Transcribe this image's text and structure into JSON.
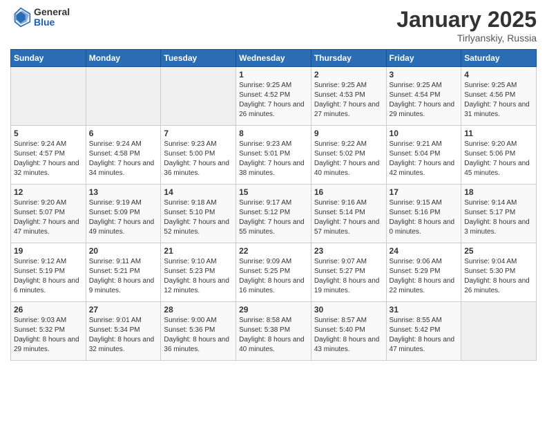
{
  "logo": {
    "general": "General",
    "blue": "Blue"
  },
  "header": {
    "month": "January 2025",
    "location": "Tirlyanskiy, Russia"
  },
  "days_of_week": [
    "Sunday",
    "Monday",
    "Tuesday",
    "Wednesday",
    "Thursday",
    "Friday",
    "Saturday"
  ],
  "weeks": [
    [
      {
        "day": "",
        "sunrise": "",
        "sunset": "",
        "daylight": ""
      },
      {
        "day": "",
        "sunrise": "",
        "sunset": "",
        "daylight": ""
      },
      {
        "day": "",
        "sunrise": "",
        "sunset": "",
        "daylight": ""
      },
      {
        "day": "1",
        "sunrise": "Sunrise: 9:25 AM",
        "sunset": "Sunset: 4:52 PM",
        "daylight": "Daylight: 7 hours and 26 minutes."
      },
      {
        "day": "2",
        "sunrise": "Sunrise: 9:25 AM",
        "sunset": "Sunset: 4:53 PM",
        "daylight": "Daylight: 7 hours and 27 minutes."
      },
      {
        "day": "3",
        "sunrise": "Sunrise: 9:25 AM",
        "sunset": "Sunset: 4:54 PM",
        "daylight": "Daylight: 7 hours and 29 minutes."
      },
      {
        "day": "4",
        "sunrise": "Sunrise: 9:25 AM",
        "sunset": "Sunset: 4:56 PM",
        "daylight": "Daylight: 7 hours and 31 minutes."
      }
    ],
    [
      {
        "day": "5",
        "sunrise": "Sunrise: 9:24 AM",
        "sunset": "Sunset: 4:57 PM",
        "daylight": "Daylight: 7 hours and 32 minutes."
      },
      {
        "day": "6",
        "sunrise": "Sunrise: 9:24 AM",
        "sunset": "Sunset: 4:58 PM",
        "daylight": "Daylight: 7 hours and 34 minutes."
      },
      {
        "day": "7",
        "sunrise": "Sunrise: 9:23 AM",
        "sunset": "Sunset: 5:00 PM",
        "daylight": "Daylight: 7 hours and 36 minutes."
      },
      {
        "day": "8",
        "sunrise": "Sunrise: 9:23 AM",
        "sunset": "Sunset: 5:01 PM",
        "daylight": "Daylight: 7 hours and 38 minutes."
      },
      {
        "day": "9",
        "sunrise": "Sunrise: 9:22 AM",
        "sunset": "Sunset: 5:02 PM",
        "daylight": "Daylight: 7 hours and 40 minutes."
      },
      {
        "day": "10",
        "sunrise": "Sunrise: 9:21 AM",
        "sunset": "Sunset: 5:04 PM",
        "daylight": "Daylight: 7 hours and 42 minutes."
      },
      {
        "day": "11",
        "sunrise": "Sunrise: 9:20 AM",
        "sunset": "Sunset: 5:06 PM",
        "daylight": "Daylight: 7 hours and 45 minutes."
      }
    ],
    [
      {
        "day": "12",
        "sunrise": "Sunrise: 9:20 AM",
        "sunset": "Sunset: 5:07 PM",
        "daylight": "Daylight: 7 hours and 47 minutes."
      },
      {
        "day": "13",
        "sunrise": "Sunrise: 9:19 AM",
        "sunset": "Sunset: 5:09 PM",
        "daylight": "Daylight: 7 hours and 49 minutes."
      },
      {
        "day": "14",
        "sunrise": "Sunrise: 9:18 AM",
        "sunset": "Sunset: 5:10 PM",
        "daylight": "Daylight: 7 hours and 52 minutes."
      },
      {
        "day": "15",
        "sunrise": "Sunrise: 9:17 AM",
        "sunset": "Sunset: 5:12 PM",
        "daylight": "Daylight: 7 hours and 55 minutes."
      },
      {
        "day": "16",
        "sunrise": "Sunrise: 9:16 AM",
        "sunset": "Sunset: 5:14 PM",
        "daylight": "Daylight: 7 hours and 57 minutes."
      },
      {
        "day": "17",
        "sunrise": "Sunrise: 9:15 AM",
        "sunset": "Sunset: 5:16 PM",
        "daylight": "Daylight: 8 hours and 0 minutes."
      },
      {
        "day": "18",
        "sunrise": "Sunrise: 9:14 AM",
        "sunset": "Sunset: 5:17 PM",
        "daylight": "Daylight: 8 hours and 3 minutes."
      }
    ],
    [
      {
        "day": "19",
        "sunrise": "Sunrise: 9:12 AM",
        "sunset": "Sunset: 5:19 PM",
        "daylight": "Daylight: 8 hours and 6 minutes."
      },
      {
        "day": "20",
        "sunrise": "Sunrise: 9:11 AM",
        "sunset": "Sunset: 5:21 PM",
        "daylight": "Daylight: 8 hours and 9 minutes."
      },
      {
        "day": "21",
        "sunrise": "Sunrise: 9:10 AM",
        "sunset": "Sunset: 5:23 PM",
        "daylight": "Daylight: 8 hours and 12 minutes."
      },
      {
        "day": "22",
        "sunrise": "Sunrise: 9:09 AM",
        "sunset": "Sunset: 5:25 PM",
        "daylight": "Daylight: 8 hours and 16 minutes."
      },
      {
        "day": "23",
        "sunrise": "Sunrise: 9:07 AM",
        "sunset": "Sunset: 5:27 PM",
        "daylight": "Daylight: 8 hours and 19 minutes."
      },
      {
        "day": "24",
        "sunrise": "Sunrise: 9:06 AM",
        "sunset": "Sunset: 5:29 PM",
        "daylight": "Daylight: 8 hours and 22 minutes."
      },
      {
        "day": "25",
        "sunrise": "Sunrise: 9:04 AM",
        "sunset": "Sunset: 5:30 PM",
        "daylight": "Daylight: 8 hours and 26 minutes."
      }
    ],
    [
      {
        "day": "26",
        "sunrise": "Sunrise: 9:03 AM",
        "sunset": "Sunset: 5:32 PM",
        "daylight": "Daylight: 8 hours and 29 minutes."
      },
      {
        "day": "27",
        "sunrise": "Sunrise: 9:01 AM",
        "sunset": "Sunset: 5:34 PM",
        "daylight": "Daylight: 8 hours and 32 minutes."
      },
      {
        "day": "28",
        "sunrise": "Sunrise: 9:00 AM",
        "sunset": "Sunset: 5:36 PM",
        "daylight": "Daylight: 8 hours and 36 minutes."
      },
      {
        "day": "29",
        "sunrise": "Sunrise: 8:58 AM",
        "sunset": "Sunset: 5:38 PM",
        "daylight": "Daylight: 8 hours and 40 minutes."
      },
      {
        "day": "30",
        "sunrise": "Sunrise: 8:57 AM",
        "sunset": "Sunset: 5:40 PM",
        "daylight": "Daylight: 8 hours and 43 minutes."
      },
      {
        "day": "31",
        "sunrise": "Sunrise: 8:55 AM",
        "sunset": "Sunset: 5:42 PM",
        "daylight": "Daylight: 8 hours and 47 minutes."
      },
      {
        "day": "",
        "sunrise": "",
        "sunset": "",
        "daylight": ""
      }
    ]
  ]
}
